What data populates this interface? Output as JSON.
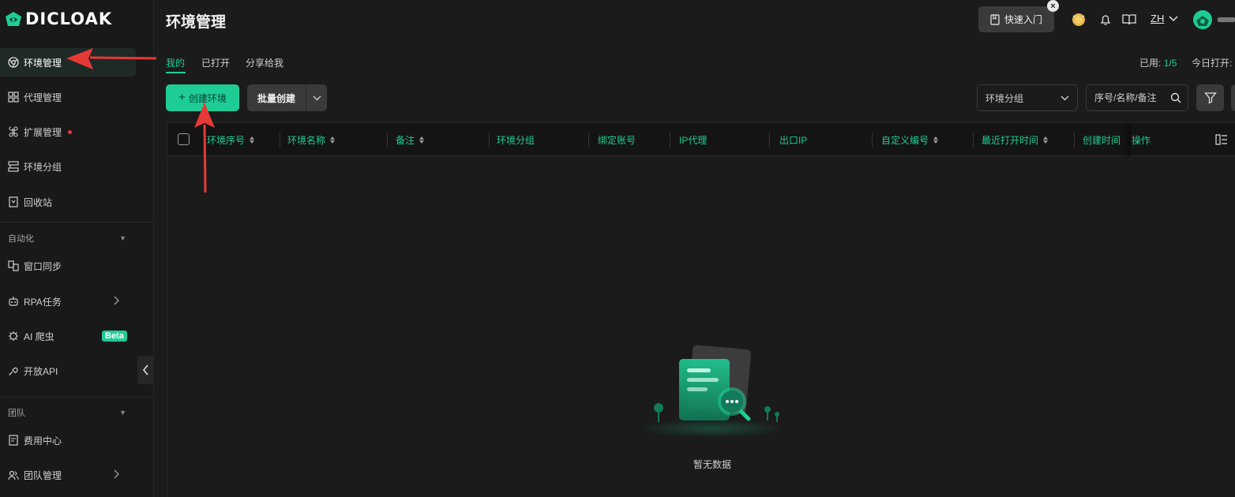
{
  "app": {
    "logo_text": "DICLOAK"
  },
  "sidebar": {
    "items": [
      {
        "label": "环境管理",
        "icon": "chrome-icon",
        "active": true
      },
      {
        "label": "代理管理",
        "icon": "proxy-icon"
      },
      {
        "label": "扩展管理",
        "icon": "extension-icon",
        "badge_dot": true
      },
      {
        "label": "环境分组",
        "icon": "group-icon"
      },
      {
        "label": "回收站",
        "icon": "trash-icon"
      }
    ],
    "sections": [
      {
        "title": "自动化",
        "items": [
          {
            "label": "窗口同步",
            "icon": "sync-icon"
          },
          {
            "label": "RPA任务",
            "icon": "robot-icon",
            "has_submenu": true
          },
          {
            "label": "AI 爬虫",
            "icon": "bug-icon",
            "tag": "Beta"
          },
          {
            "label": "开放API",
            "icon": "api-icon"
          }
        ]
      },
      {
        "title": "团队",
        "items": [
          {
            "label": "费用中心",
            "icon": "billing-icon"
          },
          {
            "label": "团队管理",
            "icon": "team-icon",
            "has_submenu": true
          }
        ]
      }
    ]
  },
  "header": {
    "title": "环境管理",
    "quick_start_label": "快速入门",
    "language": "ZH"
  },
  "tabs": [
    {
      "label": "我的",
      "active": true
    },
    {
      "label": "已打开"
    },
    {
      "label": "分享给我"
    }
  ],
  "usage": {
    "used_label": "已用:",
    "used_value": "1/5",
    "today_label": "今日打开:"
  },
  "toolbar": {
    "create_label": "创建环境",
    "batch_label": "批量创建",
    "group_select_value": "环境分组",
    "search_placeholder": "序号/名称/备注"
  },
  "table": {
    "columns": [
      {
        "label": "环境序号",
        "sortable": true
      },
      {
        "label": "环境名称",
        "sortable": true
      },
      {
        "label": "备注",
        "sortable": true
      },
      {
        "label": "环境分组"
      },
      {
        "label": "绑定账号"
      },
      {
        "label": "IP代理"
      },
      {
        "label": "出口IP"
      },
      {
        "label": "自定义编号",
        "sortable": true
      },
      {
        "label": "最近打开时间",
        "sortable": true
      },
      {
        "label": "创建时间"
      },
      {
        "label": "操作"
      }
    ],
    "empty_text": "暂无数据"
  },
  "colors": {
    "accent": "#1ecd95",
    "background": "#1b1b1b",
    "sidebar": "#191919",
    "annotation": "#e53935"
  }
}
